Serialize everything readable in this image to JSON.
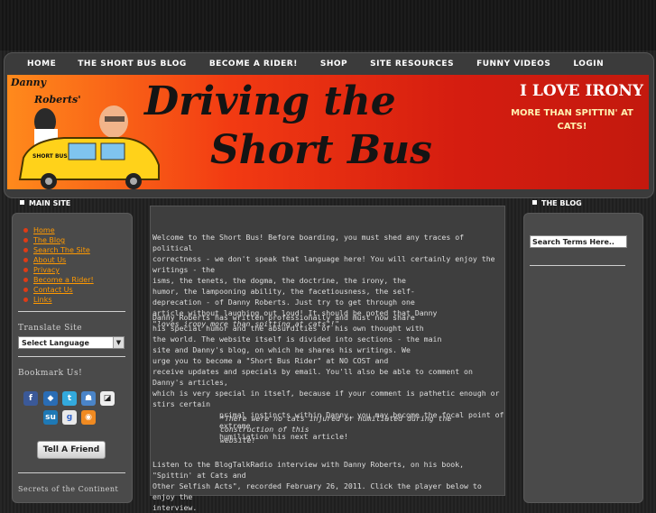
{
  "nav": {
    "items": [
      "HOME",
      "THE SHORT BUS BLOG",
      "BECOME A RIDER!",
      "SHOP",
      "SITE RESOURCES",
      "FUNNY VIDEOS",
      "LOGIN"
    ]
  },
  "header": {
    "author_line1": "Danny",
    "author_line2": "Roberts'",
    "title_line1": "Driving the",
    "title_line2": "Short Bus",
    "slogan_title": "I LOVE IRONY",
    "slogan_sub": "MORE THAN SPITTIN' AT CATS!",
    "bus_text": "SHORT BUS"
  },
  "left": {
    "heading": "MAIN SITE",
    "menu": [
      "Home",
      "The Blog",
      "Search The Site",
      "About Us",
      "Privacy",
      "Become a Rider!",
      "Contact Us",
      "Links"
    ],
    "translate_label": "Translate Site",
    "language_select": "Select Language",
    "bookmark_label": "Bookmark Us!",
    "tell_button": "Tell A Friend",
    "bottom_text": "Secrets of the Continent"
  },
  "right": {
    "heading": "THE BLOG",
    "search_value": "Search Terms Here.."
  },
  "main": {
    "para1": [
      "Welcome to the Short Bus! Before boarding, you must shed any traces of political",
      "correctness - we don't speak that language here! You will certainly enjoy the writings - the",
      "isms, the tenets, the dogma, the doctrine, the irony, the",
      "humor, the lampooning ability, the facetiousness, the self-",
      "deprecation - of Danny Roberts. Just try to get through one",
      "article without laughing out loud! It should be noted that Danny",
      "\"loves irony more than spitting at cats\"!\""
    ],
    "para2": [
      "Danny Roberts has written professionally and must now share",
      "his special humor and the absurdities of his own thought with",
      "the world. The website itself is divided into sections - the main",
      "site and Danny's blog, on which he shares his writings. We",
      "urge you to become a \"Short Bus Rider\" at NO COST and",
      "receive updates and specials by email. You'll also be able to comment on Danny's articles,",
      "which is very special in itself, because if your comment is pathetic enough or stirs certain",
      "primal instincts within Danny, you may become the focal point of extreme",
      "humiliation his next article!"
    ],
    "note": [
      "*There were no cats injured or humiliated during the construction of this",
      "website!"
    ],
    "para3": [
      "Listen to the BlogTalkRadio interview with Danny Roberts, on his book, \"Spittin' at Cats and",
      "Other Selfish Acts\", recorded February 26, 2011. Click the player below to enjoy the",
      "interview."
    ]
  },
  "colors": {
    "accent_orange": "#ff9900",
    "banner_red": "#d51d10",
    "banner_orange": "#ff8a1c"
  }
}
